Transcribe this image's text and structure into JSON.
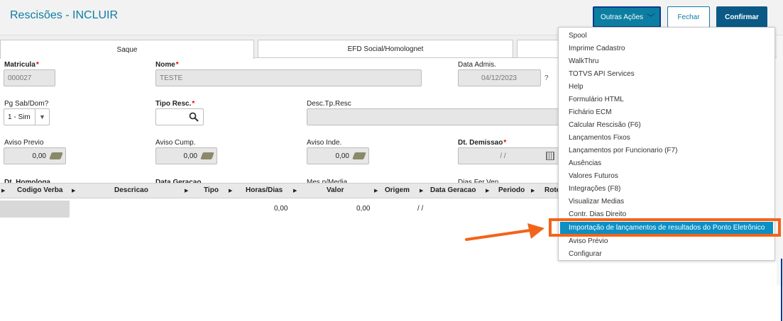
{
  "header": {
    "title": "Rescisões - INCLUIR",
    "outras_acoes": "Outras Ações",
    "fechar": "Fechar",
    "confirmar": "Confirmar"
  },
  "tabs": [
    {
      "label": "Saque"
    },
    {
      "label": "EFD Social/Homolognet"
    }
  ],
  "fields": {
    "matricula": {
      "label": "Matricula",
      "value": "000027"
    },
    "nome": {
      "label": "Nome",
      "value": "TESTE"
    },
    "data_admis": {
      "label": "Data Admis.",
      "value": "04/12/2023",
      "help": "?"
    },
    "pg_sab_dom": {
      "label": "Pg Sab/Dom?",
      "value": "1 - Sim"
    },
    "tipo_resc": {
      "label": "Tipo Resc.",
      "value": ""
    },
    "desc_tp_resc": {
      "label": "Desc.Tp.Resc",
      "value": ""
    },
    "aviso_previo": {
      "label": "Aviso Previo",
      "value": "0,00"
    },
    "aviso_cump": {
      "label": "Aviso Cump.",
      "value": "0,00"
    },
    "aviso_inde": {
      "label": "Aviso Inde.",
      "value": "0,00"
    },
    "dt_demissao": {
      "label": "Dt. Demissao",
      "value": "/ /"
    },
    "cut1": "Dt. Homologa",
    "cut2": "Data Geracao",
    "cut3": "Mes p/Media",
    "cut4": "Dias Fer.Ven."
  },
  "grid": {
    "headers": [
      "Codigo Verba",
      "Descricao",
      "Tipo",
      "Horas/Dias",
      "Valor",
      "Origem",
      "Data Geracao",
      "Periodo",
      "Rote"
    ],
    "row": {
      "horas": "0,00",
      "valor": "0,00",
      "data": "/ /"
    }
  },
  "menu": {
    "items": [
      "Spool",
      "Imprime Cadastro",
      "WalkThru",
      "TOTVS API Services",
      "Help",
      "Formulário HTML",
      "Fichário ECM",
      "Calcular Rescisão (F6)",
      "Lançamentos Fixos",
      "Lançamentos por Funcionario (F7)",
      "Ausências",
      "Valores Futuros",
      "Integrações (F8)",
      "Visualizar Medias",
      "Contr. Dias Direito",
      "Importação de lançamentos de resultados do Ponto Eletrônico",
      "Aviso Prévio",
      "Configurar"
    ],
    "selected_index": 15
  },
  "colors": {
    "accent": "#0c7ea1",
    "highlight": "#f26419",
    "selected": "#0c8fc3"
  }
}
